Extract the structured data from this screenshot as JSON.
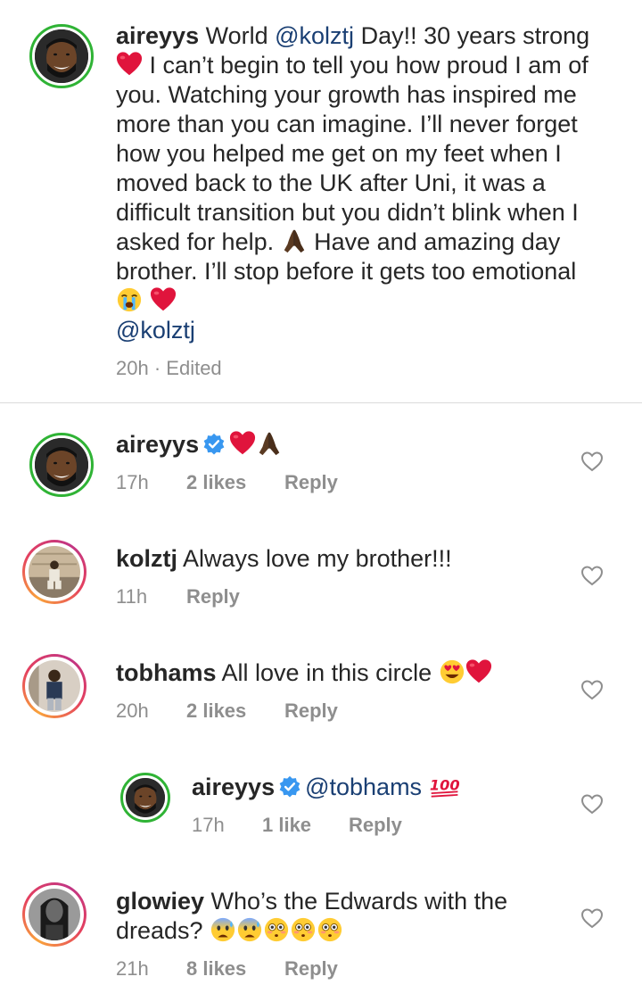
{
  "caption": {
    "username": "aireyys",
    "part1": " World ",
    "mention1": "@kolztj",
    "part2": " Day!! 30 years strong ",
    "part3": " I can’t begin to tell you how proud I am of you. Watching your growth has inspired me more than you can imagine. I’ll never forget how you helped me get on my feet when I moved back to the UK after Uni, it was a difficult transition but you didn’t blink when I asked for help. ",
    "part4": " Have and amazing day brother. I’ll stop before it gets too emotional ",
    "mention2": "@kolztj",
    "time": "20h",
    "sep": " · ",
    "edited": "Edited"
  },
  "comments": [
    {
      "username": "aireyys",
      "verified": true,
      "text": "",
      "time": "17h",
      "likes": "2 likes",
      "reply": "Reply"
    },
    {
      "username": "kolztj",
      "text": " Always love my brother!!!",
      "time": "11h",
      "reply": "Reply"
    },
    {
      "username": "tobhams",
      "text": " All love in this circle ",
      "time": "20h",
      "likes": "2 likes",
      "reply": "Reply"
    },
    {
      "username": "aireyys",
      "verified": true,
      "mention": "@tobhams",
      "time": "17h",
      "likes": "1 like",
      "reply": "Reply"
    },
    {
      "username": "glowiey",
      "text_line1": " Who’s the Edwards with the",
      "text_line2": "dreads? ",
      "time": "21h",
      "likes": "8 likes",
      "reply": "Reply"
    }
  ],
  "colors": {
    "text": "#262626",
    "meta": "#8e8e8e",
    "mention": "#1a3f73",
    "verified": "#3897f0",
    "story_ring": "#e4405f",
    "green_ring": "#2fb335"
  },
  "icons": [
    "heart-emoji",
    "praying-hands-emoji",
    "crying-face-emoji",
    "heart-eyes-emoji",
    "hundred-points-emoji",
    "anxious-sweat-emoji",
    "flushed-face-emoji",
    "verified-badge-icon",
    "like-heart-icon"
  ]
}
